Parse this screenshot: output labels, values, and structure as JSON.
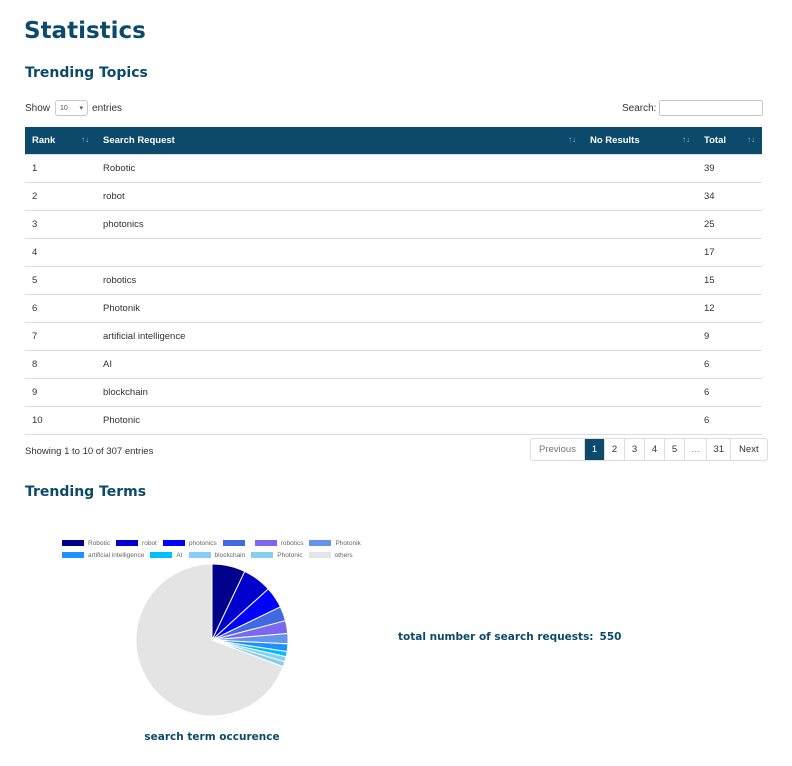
{
  "page": {
    "title": "Statistics"
  },
  "trending_topics": {
    "title": "Trending Topics",
    "length_control": {
      "show_label": "Show",
      "selected": "10",
      "entries_label": "entries"
    },
    "search": {
      "label": "Search:",
      "value": ""
    },
    "columns": [
      "Rank",
      "Search Request",
      "No Results",
      "Total"
    ],
    "rows": [
      {
        "rank": "1",
        "request": "Robotic",
        "no_results": "",
        "total": "39"
      },
      {
        "rank": "2",
        "request": "robot",
        "no_results": "",
        "total": "34"
      },
      {
        "rank": "3",
        "request": "photonics",
        "no_results": "",
        "total": "25"
      },
      {
        "rank": "4",
        "request": "",
        "no_results": "",
        "total": "17"
      },
      {
        "rank": "5",
        "request": "robotics",
        "no_results": "",
        "total": "15"
      },
      {
        "rank": "6",
        "request": "Photonik",
        "no_results": "",
        "total": "12"
      },
      {
        "rank": "7",
        "request": "artificial intelligence",
        "no_results": "",
        "total": "9"
      },
      {
        "rank": "8",
        "request": "AI",
        "no_results": "",
        "total": "6"
      },
      {
        "rank": "9",
        "request": "blockchain",
        "no_results": "",
        "total": "6"
      },
      {
        "rank": "10",
        "request": "Photonic",
        "no_results": "",
        "total": "6"
      }
    ],
    "info": "Showing 1 to 10 of 307 entries",
    "pagination": {
      "previous": "Previous",
      "pages": [
        "1",
        "2",
        "3",
        "4",
        "5",
        "…",
        "31"
      ],
      "active": "1",
      "next": "Next"
    }
  },
  "trending_terms": {
    "title": "Trending Terms",
    "total_label": "total number of search requests:",
    "total_value": "550",
    "chart_caption": "search term occurence"
  },
  "chart_data": {
    "type": "pie",
    "title": "search term occurence",
    "legend_position": "top",
    "slices": [
      {
        "label": "Robotic",
        "value": 39,
        "color": "#00008b"
      },
      {
        "label": "robot",
        "value": 34,
        "color": "#0000cd"
      },
      {
        "label": "photonics",
        "value": 25,
        "color": "#0000ff"
      },
      {
        "label": "",
        "value": 17,
        "color": "#4169e1"
      },
      {
        "label": "robotics",
        "value": 15,
        "color": "#7b68ee"
      },
      {
        "label": "Photonik",
        "value": 12,
        "color": "#6495ed"
      },
      {
        "label": "artificial intelligence",
        "value": 9,
        "color": "#1e90ff"
      },
      {
        "label": "AI",
        "value": 6,
        "color": "#00bfff"
      },
      {
        "label": "blockchain",
        "value": 6,
        "color": "#87cefa"
      },
      {
        "label": "Photonic",
        "value": 6,
        "color": "#87ceeb"
      },
      {
        "label": "others",
        "value": 381,
        "color": "#e4e4e4"
      }
    ]
  }
}
